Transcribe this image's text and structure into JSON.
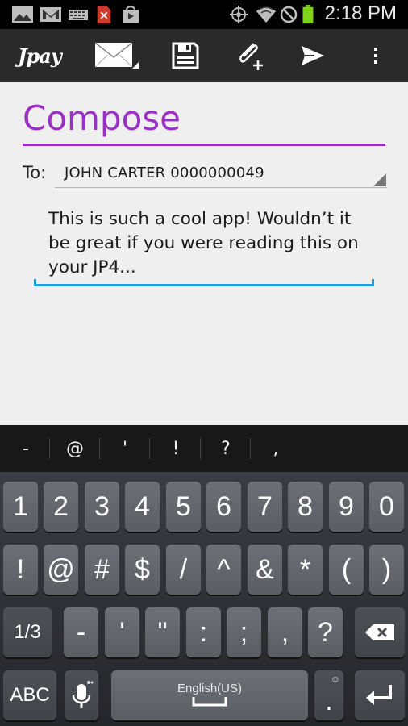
{
  "status_bar": {
    "time": "2:18 PM",
    "icons": [
      "gallery-icon",
      "gmail-icon",
      "keyboard-icon",
      "sdcard-error-icon",
      "play-store-icon",
      "gps-icon",
      "wifi-icon",
      "no-signal-icon",
      "battery-icon"
    ]
  },
  "action_bar": {
    "logo": "Jpay",
    "icons": [
      "mail-icon",
      "save-icon",
      "attach-icon",
      "send-icon",
      "overflow-menu-icon"
    ]
  },
  "compose": {
    "title": "Compose",
    "to_label": "To:",
    "recipient": "JOHN CARTER 0000000049",
    "message": "This is such a cool app! Wouldn’t it be great if you were reading this on your JP4..."
  },
  "suggestions": [
    "-",
    "@",
    "'",
    "!",
    "?",
    ","
  ],
  "keyboard": {
    "row1": [
      "1",
      "2",
      "3",
      "4",
      "5",
      "6",
      "7",
      "8",
      "9",
      "0"
    ],
    "row2": [
      "!",
      "@",
      "#",
      "$",
      "/",
      "^",
      "&",
      "*",
      "(",
      ")"
    ],
    "row3_left": "1/3",
    "row3": [
      "-",
      "'",
      "\"",
      ":",
      ";",
      ",",
      "?"
    ],
    "abc": "ABC",
    "space_label": "English(US)",
    "period": "."
  },
  "colors": {
    "accent": "#9b31c4",
    "input_underline": "#1aa1d8",
    "battery": "#7fd319"
  }
}
